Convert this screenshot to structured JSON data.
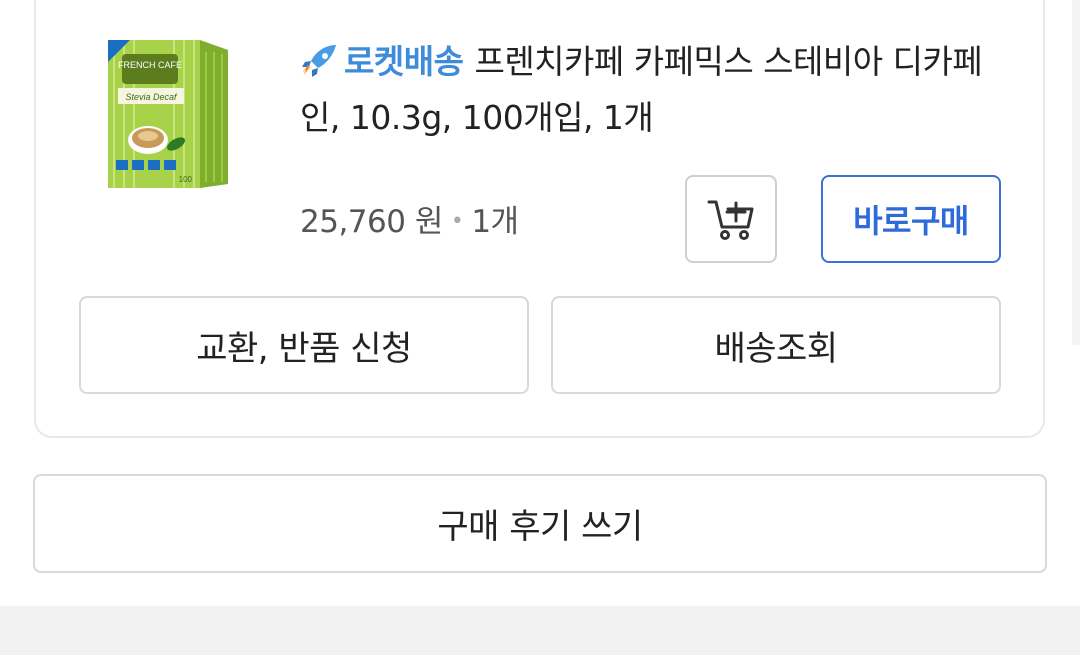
{
  "product": {
    "badge_label": "로켓배송",
    "badge_icon": "rocket-icon",
    "title": "프렌치카페 카페믹스 스테비아 디카페인, 10.3g, 100개입, 1개",
    "price": "25,760 원",
    "quantity": "1개",
    "image_icon": "product-box-image",
    "image_brand_text": "FRENCH CAFE",
    "image_product_text": "Stevia Decaf",
    "image_count_text": "100"
  },
  "actions": {
    "cart_icon": "add-to-cart-icon",
    "buy_now_label": "바로구매",
    "exchange_return_label": "교환, 반품 신청",
    "shipping_tracking_label": "배송조회",
    "write_review_label": "구매 후기 쓰기"
  },
  "colors": {
    "accent_blue": "#2f6bd8",
    "rocket_blue": "#3d8bd9",
    "border_gray": "#d9d9d9",
    "product_green": "#a8d24a"
  }
}
